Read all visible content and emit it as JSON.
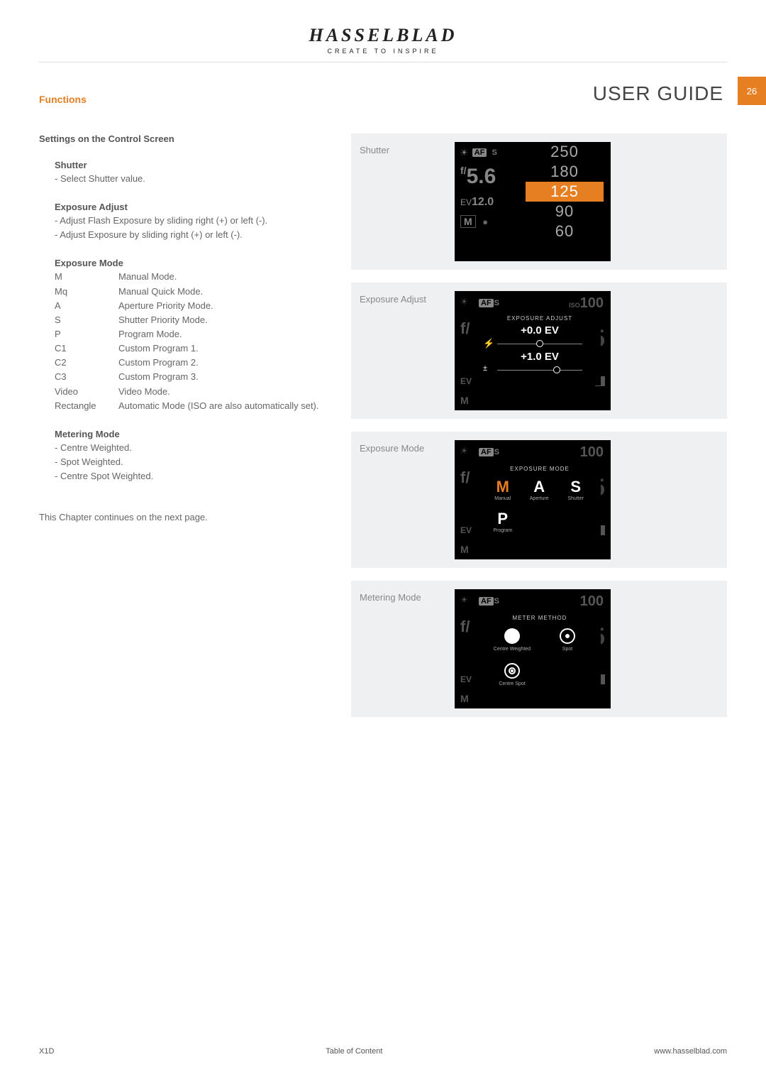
{
  "brand": {
    "name": "HASSELBLAD",
    "tagline": "CREATE TO INSPIRE"
  },
  "header": {
    "section": "Functions",
    "guide": "USER GUIDE",
    "page": "26"
  },
  "leftcol": {
    "title": "Settings on the Control Screen",
    "shutter": {
      "heading": "Shutter",
      "line1": "- Select Shutter value."
    },
    "expadj": {
      "heading": "Exposure Adjust",
      "line1": "- Adjust Flash Exposure by sliding right (+) or left (-).",
      "line2": "- Adjust Exposure by sliding right (+) or left (-)."
    },
    "expmode": {
      "heading": "Exposure Mode",
      "rows": [
        {
          "k": "M",
          "v": "Manual Mode."
        },
        {
          "k": "Mq",
          "v": "Manual Quick Mode."
        },
        {
          "k": "A",
          "v": "Aperture Priority Mode."
        },
        {
          "k": "S",
          "v": "Shutter Priority Mode."
        },
        {
          "k": "P",
          "v": "Program Mode."
        },
        {
          "k": "C1",
          "v": "Custom Program 1."
        },
        {
          "k": "C2",
          "v": "Custom Program 2."
        },
        {
          "k": "C3",
          "v": "Custom Program 3."
        },
        {
          "k": "Video",
          "v": "Video Mode."
        },
        {
          "k": "Rectangle",
          "v": "Automatic Mode (ISO are also automatically set)."
        }
      ]
    },
    "metering": {
      "heading": "Metering Mode",
      "line1": "- Centre Weighted.",
      "line2": "- Spot Weighted.",
      "line3": "- Centre Spot Weighted."
    },
    "note": "This Chapter continues on the next page."
  },
  "cards": {
    "shutter": {
      "label": "Shutter",
      "af": "AF",
      "afS": "S",
      "f": "5.6",
      "fpre": "f/",
      "ev": "12.0",
      "evpre": "EV",
      "m": "M",
      "list": [
        "250",
        "180",
        "125",
        "90",
        "60"
      ],
      "selectedIndex": 2
    },
    "expadj": {
      "label": "Exposure Adjust",
      "panelTitle": "EXPOSURE ADJUST",
      "iso": "100",
      "isoPre": "ISO",
      "flashVal": "+0.0 EV",
      "evVal": "+1.0 EV",
      "flashKnob": 50,
      "evKnob": 70
    },
    "expmode": {
      "label": "Exposure Mode",
      "panelTitle": "EXPOSURE MODE",
      "iso": "100",
      "items": [
        {
          "letter": "M",
          "sub": "Manual",
          "sel": true
        },
        {
          "letter": "A",
          "sub": "Aperture",
          "sel": false
        },
        {
          "letter": "S",
          "sub": "Shutter",
          "sel": false
        },
        {
          "letter": "P",
          "sub": "Program",
          "sel": false
        }
      ]
    },
    "metering": {
      "label": "Metering Mode",
      "panelTitle": "METER METHOD",
      "iso": "100",
      "items": [
        {
          "kind": "circle",
          "sub": "Centre Weighted"
        },
        {
          "kind": "dot",
          "sub": "Spot"
        },
        {
          "kind": "centrespot",
          "sub": "Centre Spot"
        }
      ]
    }
  },
  "footer": {
    "left": "X1D",
    "center": "Table of Content",
    "right": "www.hasselblad.com"
  }
}
